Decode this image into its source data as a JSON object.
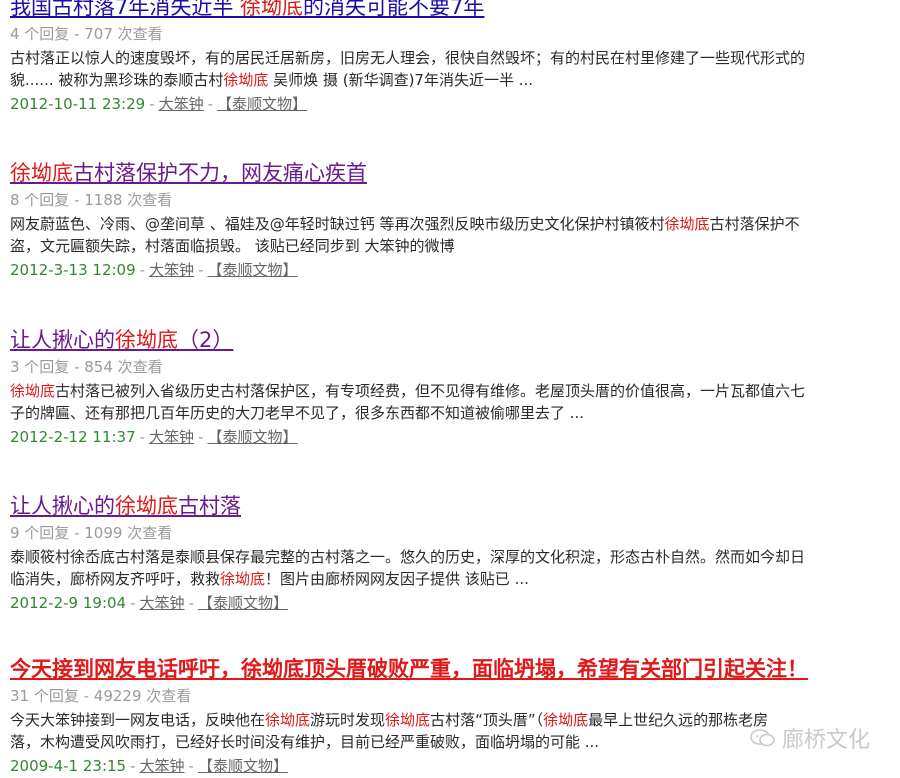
{
  "results": [
    {
      "title_parts": [
        "我国古村落7年消失近半 ",
        "徐坳底",
        "的消失可能不要7年"
      ],
      "meta": "4 个回复 - 707 次查看",
      "snippet_line1_parts": [
        "古村落正以惊人的速度毁坏，有的居民迁居新房，旧房无人理会，很快自然毁坏；有的村民在村里修建了一些现代形式的"
      ],
      "snippet_line2_parts": [
        "貌...... 被称为黑珍珠的泰顺古村",
        "徐坳底",
        " 吴师焕 摄 (新华调查)7年消失近一半 ..."
      ],
      "date": "2012-10-11 23:29",
      "author": "大笨钟",
      "category": "【泰顺文物】"
    },
    {
      "title_parts": [
        "徐坳底",
        "古村落保护不力，网友痛心疾首"
      ],
      "meta": "8 个回复 - 1188 次查看",
      "snippet_line1_parts": [
        "网友蔚蓝色、冷雨、@垄间草 、福娃及@年轻时缺过钙 等再次强烈反映市级历史文化保护村镇筱村",
        "徐坳底",
        "古村落保护不"
      ],
      "snippet_line2_parts": [
        "盗，文元匾额失踪，村落面临损毁。 该贴已经同步到 大笨钟的微博"
      ],
      "date": "2012-3-13 12:09",
      "author": "大笨钟",
      "category": "【泰顺文物】"
    },
    {
      "title_parts": [
        "让人揪心的",
        "徐坳底",
        "（2）"
      ],
      "meta": "3 个回复 - 854 次查看",
      "snippet_line1_parts": [
        "",
        "徐坳底",
        "古村落已被列入省级历史古村落保护区，有专项经费，但不见得有维修。老屋顶头厝的价值很高，一片瓦都值六七"
      ],
      "snippet_line2_parts": [
        "子的牌匾、还有那把几百年历史的大刀老早不见了，很多东西都不知道被偷哪里去了 ..."
      ],
      "date": "2012-2-12 11:37",
      "author": "大笨钟",
      "category": "【泰顺文物】"
    },
    {
      "title_parts": [
        "让人揪心的",
        "徐坳底",
        "古村落"
      ],
      "meta": "9 个回复 - 1099 次查看",
      "snippet_line1_parts": [
        "泰顺筱村徐岙底古村落是泰顺县保存最完整的古村落之一。悠久的历史，深厚的文化积淀，形态古朴自然。然而如今却日"
      ],
      "snippet_line2_parts": [
        "临消失，廊桥网友齐呼吁，救救",
        "徐坳底",
        "！图片由廊桥网网友因子提供 该贴已 ..."
      ],
      "date": "2012-2-9 19:04",
      "author": "大笨钟",
      "category": "【泰顺文物】"
    },
    {
      "title_parts": [
        "今天接到网友电话呼吁，徐坳底顶头厝破败严重，面临坍塌，希望有关部门引起关注！"
      ],
      "meta": "31 个回复 - 49229 次查看",
      "snippet_line1_parts": [
        "今天大笨钟接到一网友电话，反映他在",
        "徐坳底",
        "游玩时发现",
        "徐坳底",
        "古村落“顶头厝”（",
        "徐坳底",
        "最早上世纪久远的那栋老房"
      ],
      "snippet_line2_parts": [
        "落，木构遭受风吹雨打，已经好长时间没有维护，目前已经严重破败，面临坍塌的可能 ..."
      ],
      "date": "2009-4-1 23:15",
      "author": "大笨钟",
      "category": "【泰顺文物】"
    }
  ],
  "watermark": "廊桥文化",
  "colors": {
    "link_blue": "#1a0dab",
    "visited_purple": "#6b1a8e",
    "highlight_red": "#e01818",
    "date_green": "#2f8a2f"
  }
}
